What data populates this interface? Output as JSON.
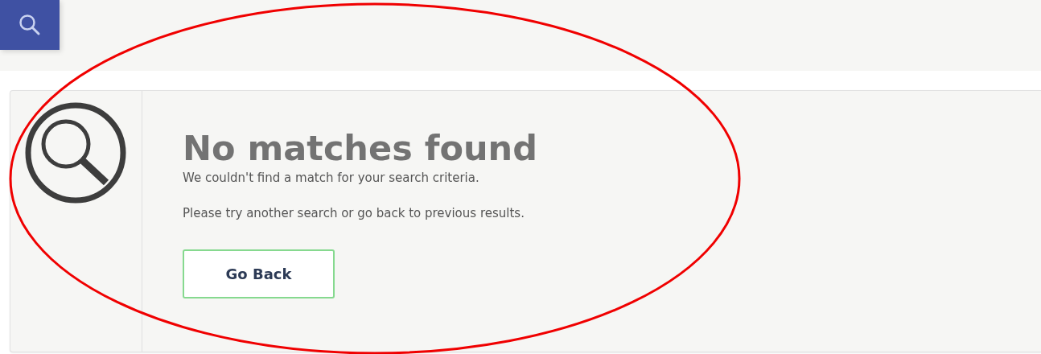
{
  "heading": "No matches found",
  "messages": [
    "We couldn't find a match for your search criteria.",
    "Please try another search or go back to previous results."
  ],
  "button": "Go Back"
}
